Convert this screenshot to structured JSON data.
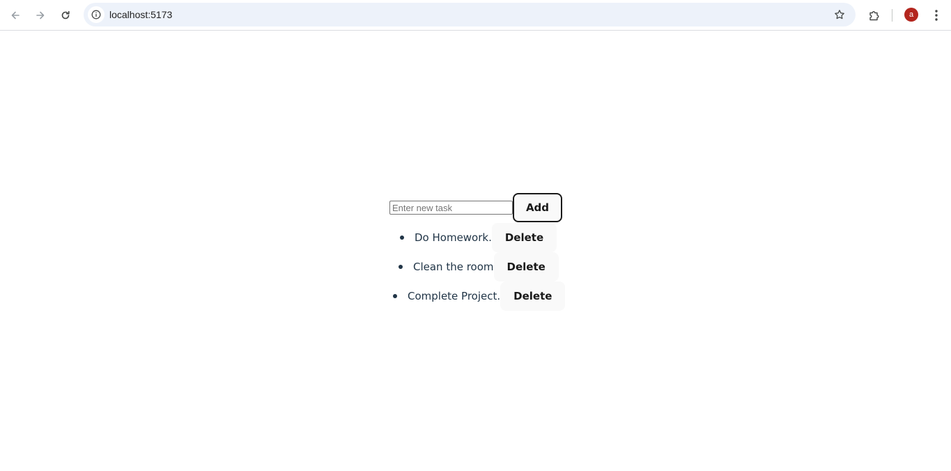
{
  "browser": {
    "url": "localhost:5173",
    "profile_initial": "a",
    "icons": [
      "back-arrow-icon",
      "forward-arrow-icon",
      "reload-icon",
      "site-info-icon",
      "bookmark-star-icon",
      "extensions-icon",
      "more-menu-icon"
    ]
  },
  "app": {
    "input_placeholder": "Enter new task",
    "input_value": "",
    "add_label": "Add",
    "tasks": [
      {
        "text": "Do Homework.",
        "delete_label": "Delete"
      },
      {
        "text": "Clean the room",
        "delete_label": "Delete"
      },
      {
        "text": "Complete Project.",
        "delete_label": "Delete"
      }
    ]
  },
  "colors": {
    "avatar": "#b3261e",
    "omnibox": "#edf2fa",
    "text": "#213547",
    "button_bg": "#f9f9f9"
  }
}
